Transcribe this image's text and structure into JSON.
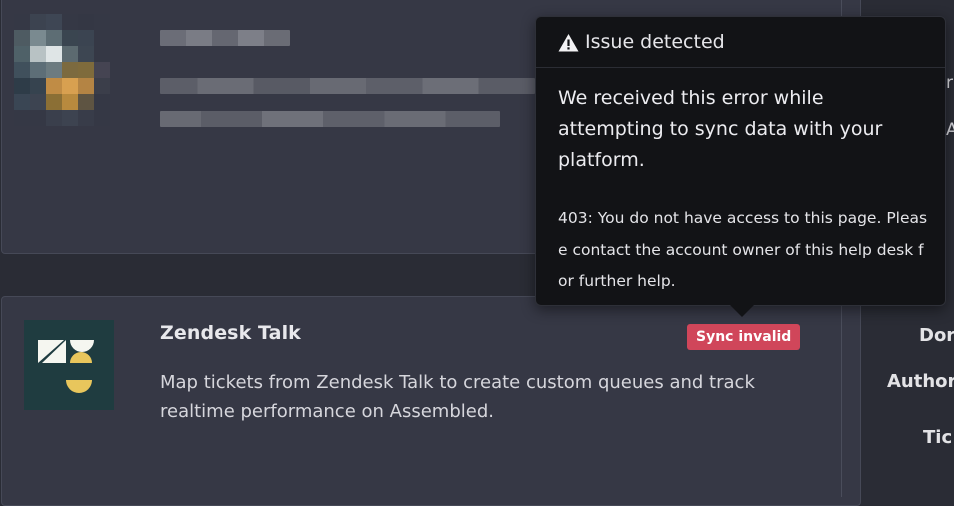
{
  "placeholder_card": {
    "pixels": [
      "#353845",
      "#3c4350",
      "#3e4654",
      "#353845",
      "#343744",
      "#353845",
      "#4e5b62",
      "#7a8a90",
      "#5d6d74",
      "#3a4550",
      "#3b4451",
      "#353845",
      "#4f6168",
      "#b8c2c4",
      "#dfe5e6",
      "#5c6a70",
      "#3d4652",
      "#353845",
      "#40505c",
      "#5d6e77",
      "#6c7b80",
      "#7c6a3f",
      "#7f6b3c",
      "#454452",
      "#2e3c48",
      "#36434f",
      "#c08c45",
      "#d8a050",
      "#b48444",
      "#3b3e4a",
      "#3a4654",
      "#3d4451",
      "#8b6f35",
      "#b88a3e",
      "#5e5442",
      "#353845",
      "#353845",
      "#353845",
      "#3a3f4c",
      "#3d4350",
      "#383c49",
      "#353845"
    ]
  },
  "app": {
    "title": "Zendesk Talk",
    "description": "Map tickets from Zendesk Talk to create custom queues and track realtime performance on Assembled.",
    "status_badge": "Sync invalid"
  },
  "side_labels": [
    "Dor",
    "Author",
    "Tic"
  ],
  "side_fragments": [
    "r",
    "A"
  ],
  "tooltip": {
    "title": "Issue detected",
    "message": "We received this error while attempting to sync data with your platform.",
    "detail": "403: You do not have access to this page. Please contact the account owner of this help desk for further help."
  },
  "colors": {
    "background": "#2a2c35",
    "card": "#363845",
    "badge": "#d0465a",
    "tooltip": "#121316",
    "logo_bg": "#1f3c40",
    "logo_accent": "#e8c65c"
  },
  "icons": [
    "warning-triangle-icon",
    "zendesk-logo-icon"
  ]
}
